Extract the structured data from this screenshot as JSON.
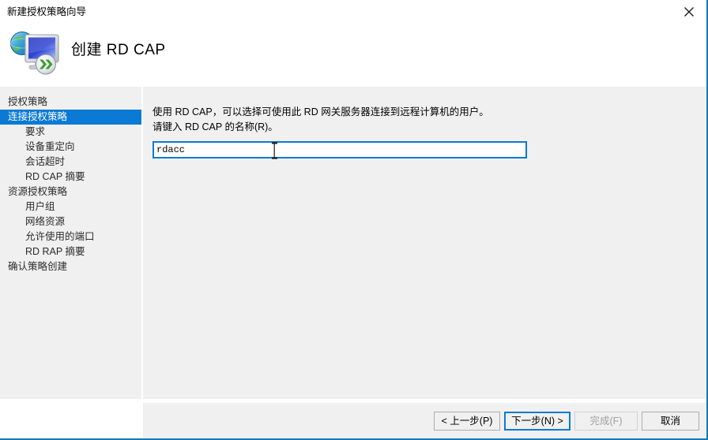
{
  "window": {
    "title": "新建授权策略向导",
    "close_icon": "close-icon"
  },
  "header": {
    "title": "创建 RD CAP",
    "icon": "rd-gateway-globe-monitor-icon"
  },
  "sidebar": {
    "items": [
      {
        "label": "授权策略",
        "level": 0,
        "selected": false
      },
      {
        "label": "连接授权策略",
        "level": 0,
        "selected": true
      },
      {
        "label": "要求",
        "level": 1,
        "selected": false
      },
      {
        "label": "设备重定向",
        "level": 1,
        "selected": false
      },
      {
        "label": "会话超时",
        "level": 1,
        "selected": false
      },
      {
        "label": "RD CAP 摘要",
        "level": 1,
        "selected": false
      },
      {
        "label": "资源授权策略",
        "level": 0,
        "selected": false
      },
      {
        "label": "用户组",
        "level": 1,
        "selected": false
      },
      {
        "label": "网络资源",
        "level": 1,
        "selected": false
      },
      {
        "label": "允许使用的端口",
        "level": 1,
        "selected": false
      },
      {
        "label": "RD RAP 摘要",
        "level": 1,
        "selected": false
      },
      {
        "label": "确认策略创建",
        "level": 0,
        "selected": false
      }
    ]
  },
  "main": {
    "intro_line1": "使用 RD CAP，可以选择可使用此 RD 网关服务器连接到远程计算机的用户。",
    "intro_line2": "请键入 RD CAP 的名称(R)。",
    "name_field": {
      "value": "rdacc",
      "placeholder": ""
    }
  },
  "footer": {
    "back_label": "< 上一步(P)",
    "next_label": "下一步(N) >",
    "finish_label": "完成(F)",
    "cancel_label": "取消"
  },
  "colors": {
    "accent": "#0b7ad4",
    "panel": "#f0f0f0",
    "window_border": "#1579b8",
    "disabled_text": "#a0a0a0"
  }
}
